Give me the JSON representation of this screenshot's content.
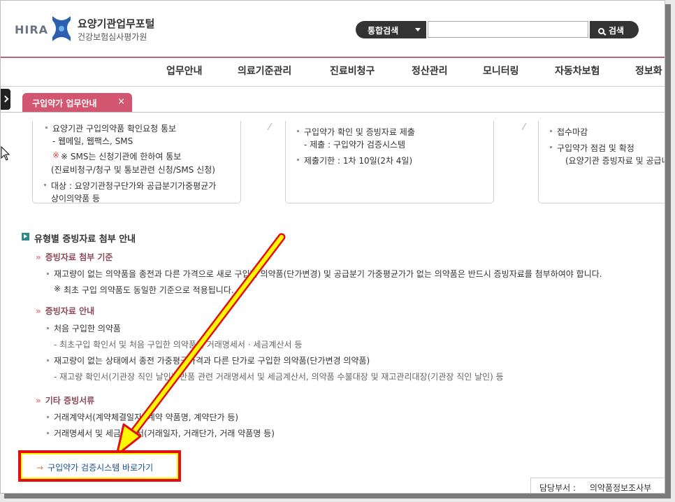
{
  "header": {
    "brand": "HIRA",
    "title": "요양기관업무포털",
    "subtitle": "건강보험심사평가원",
    "search_scope": "통합검색",
    "search_value": "",
    "search_button": "검색"
  },
  "gnb": [
    "업무안내",
    "의료기준관리",
    "진료비청구",
    "정산관리",
    "모니터링",
    "자동차보험",
    "정보화"
  ],
  "tab": {
    "label": "구입약가 업무안내",
    "close": "×"
  },
  "steps": [
    {
      "lines": [
        "요양기관 구입의약품 확인요청 통보",
        "- 웹메일, 웹팩스, SMS",
        "※ SMS는 신청기관에 한하여 통보",
        "(진료비청구/청구 및 통보관련 신청/SMS 신청)",
        "대상 : 요양기관청구단가와 공급분기가중평균가",
        "상이의약품 등"
      ]
    },
    {
      "lines": [
        "구입약가 확인 및 증빙자료 제출",
        "- 제출 : 구입약가 검증시스템",
        "제출기한 : 1차 10일(2차 4일)"
      ]
    },
    {
      "lines": [
        "접수마감",
        "구입약가 점검 및 확정",
        "(요양기관 증빙자료 및 공급내역"
      ]
    }
  ],
  "guide": {
    "title": "유형별 증빙자료 첨부 안내",
    "sections": [
      {
        "heading": "증빙자료 첨부 기준",
        "items": [
          "재고량이 없는 의약품을 종전과 다른 가격으로 새로 구입한 의약품(단가변경) 및 공급분기 가중평균가가 없는 의약품은 반드시 증빙자료를 첨부하여야 합니다.",
          "최초 구입 의약품도 동일한 기준으로 적용됩니다."
        ]
      },
      {
        "heading": "증빙자료 안내",
        "items": [
          "처음 구입한 의약품",
          "- 최초구입 확인서 및 처음 구입한 의약품의 거래명세서 · 세금계산서 등",
          "재고량이 없는 상태에서 종전 가중평균가격과 다른 단가로 구입한 의약품(단가변경 의약품)",
          "- 재고량 확인서(기관장 직인 날인), 반품 관련 거래명세서 및 세금계산서, 의약품 수불대장 및 재고관리대장(기관장 직인 날인) 등"
        ]
      },
      {
        "heading": "기타 증빙서류",
        "items": [
          "거래계약서(계약체결일자, 계약 약품명, 계약단가 등)",
          "거래명세서 및 세금계산서(거래일자, 거래단가, 거래 약품명 등)"
        ]
      }
    ],
    "note_mark": "※"
  },
  "quick_link": {
    "arrow": "→",
    "label": "구입약가 검증시스템 바로가기"
  },
  "dept": {
    "label": "담당부서 :",
    "value": "의약품정보조사부"
  },
  "colors": {
    "accent": "#d2566f",
    "highlight_border": "#e01010",
    "highlight_fill": "#fff700"
  }
}
